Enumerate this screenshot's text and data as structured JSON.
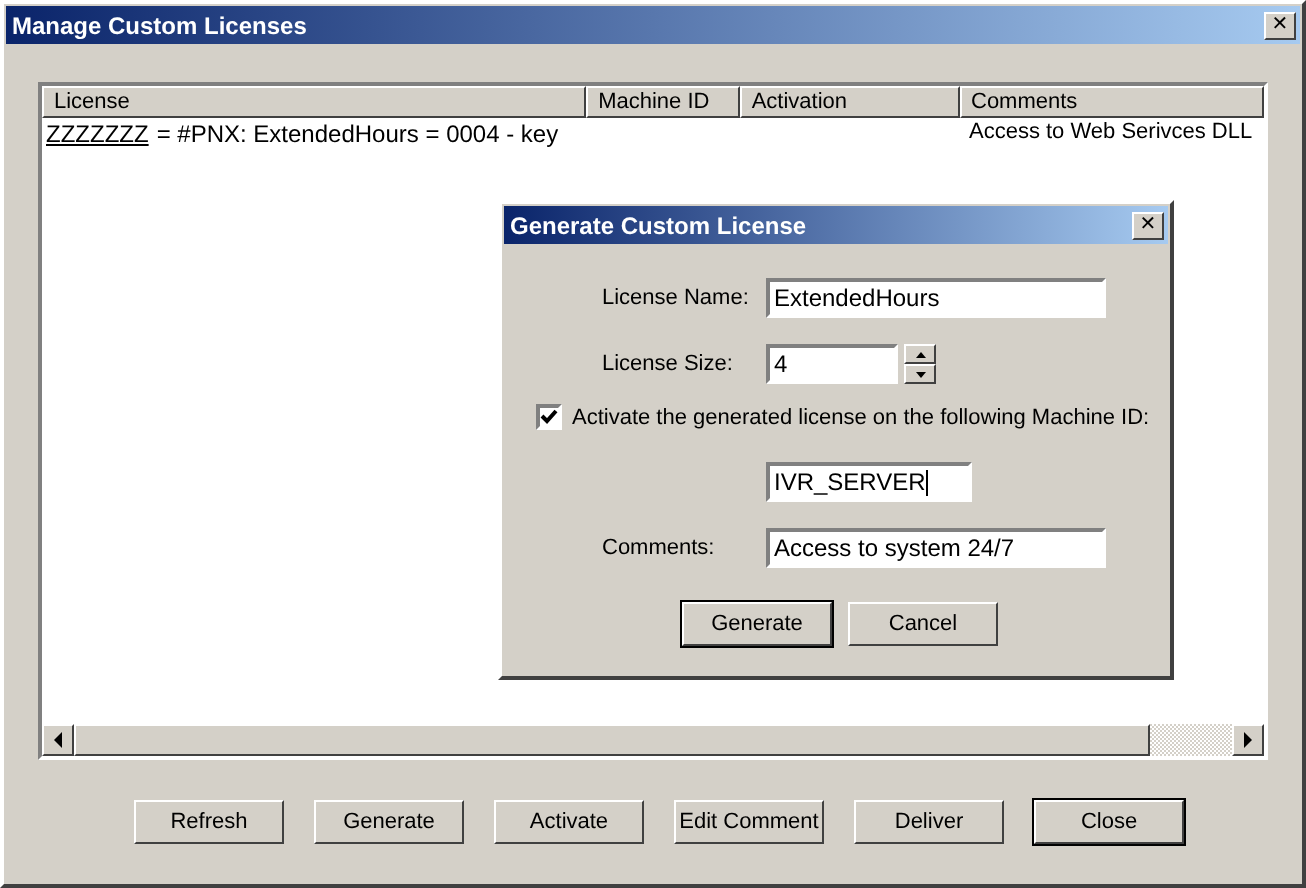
{
  "window": {
    "title": "Manage Custom Licenses",
    "close": "✕"
  },
  "table": {
    "columns": [
      "License",
      "Machine ID",
      "Activation",
      "Comments"
    ],
    "rows": [
      {
        "key": "ZZZZZZZ",
        "license": "= #PNX: ExtendedHours = 0004 - key",
        "machine_id": "",
        "activation": "",
        "comments": "Access to Web Serivces DLL"
      }
    ]
  },
  "buttons": [
    {
      "label": "Refresh",
      "default": false
    },
    {
      "label": "Generate",
      "default": false
    },
    {
      "label": "Activate",
      "default": false
    },
    {
      "label": "Edit Comment",
      "default": false
    },
    {
      "label": "Deliver",
      "default": false
    },
    {
      "label": "Close",
      "default": true
    }
  ],
  "dialog": {
    "title": "Generate Custom License",
    "close": "✕",
    "license_name": {
      "label": "License Name:",
      "value": "ExtendedHours"
    },
    "license_size": {
      "label": "License Size:",
      "value": "4"
    },
    "activate": {
      "label": "Activate the generated license on the following Machine ID:",
      "checked": true
    },
    "machine_id": {
      "value": "IVR_SERVER"
    },
    "comments": {
      "label": "Comments:",
      "value": "Access to system 24/7"
    },
    "buttons": [
      {
        "label": "Generate",
        "default": true
      },
      {
        "label": "Cancel",
        "default": false
      }
    ]
  }
}
